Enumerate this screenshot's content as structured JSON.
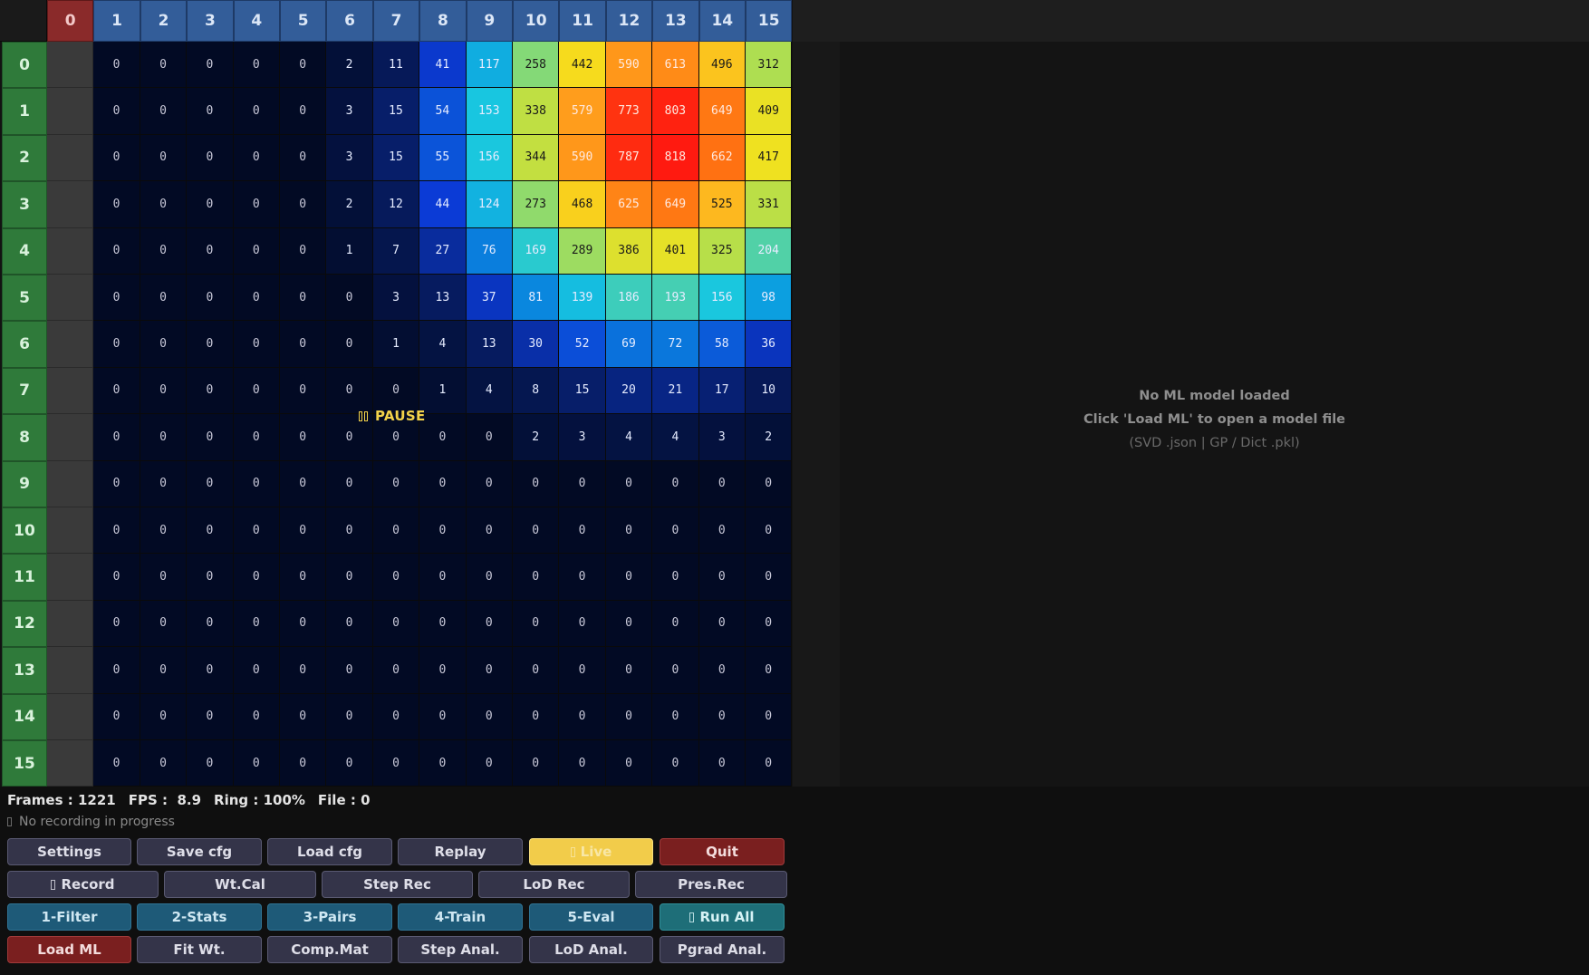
{
  "grid": {
    "col_headers": [
      "0",
      "1",
      "2",
      "3",
      "4",
      "5",
      "6",
      "7",
      "8",
      "9",
      "10",
      "11",
      "12",
      "13",
      "14",
      "15"
    ],
    "row_headers": [
      "0",
      "1",
      "2",
      "3",
      "4",
      "5",
      "6",
      "7",
      "8",
      "9",
      "10",
      "11",
      "12",
      "13",
      "14",
      "15"
    ],
    "active_col": 0,
    "values": [
      [
        null,
        0,
        0,
        0,
        0,
        0,
        2,
        11,
        41,
        117,
        258,
        442,
        590,
        613,
        496,
        312
      ],
      [
        null,
        0,
        0,
        0,
        0,
        0,
        3,
        15,
        54,
        153,
        338,
        579,
        773,
        803,
        649,
        409
      ],
      [
        null,
        0,
        0,
        0,
        0,
        0,
        3,
        15,
        55,
        156,
        344,
        590,
        787,
        818,
        662,
        417
      ],
      [
        null,
        0,
        0,
        0,
        0,
        0,
        2,
        12,
        44,
        124,
        273,
        468,
        625,
        649,
        525,
        331
      ],
      [
        null,
        0,
        0,
        0,
        0,
        0,
        1,
        7,
        27,
        76,
        169,
        289,
        386,
        401,
        325,
        204
      ],
      [
        null,
        0,
        0,
        0,
        0,
        0,
        0,
        3,
        13,
        37,
        81,
        139,
        186,
        193,
        156,
        98
      ],
      [
        null,
        0,
        0,
        0,
        0,
        0,
        0,
        1,
        4,
        13,
        30,
        52,
        69,
        72,
        58,
        36
      ],
      [
        null,
        0,
        0,
        0,
        0,
        0,
        0,
        0,
        1,
        4,
        8,
        15,
        20,
        21,
        17,
        10
      ],
      [
        null,
        0,
        0,
        0,
        0,
        0,
        0,
        0,
        0,
        0,
        2,
        3,
        4,
        4,
        3,
        2
      ],
      [
        null,
        0,
        0,
        0,
        0,
        0,
        0,
        0,
        0,
        0,
        0,
        0,
        0,
        0,
        0,
        0
      ],
      [
        null,
        0,
        0,
        0,
        0,
        0,
        0,
        0,
        0,
        0,
        0,
        0,
        0,
        0,
        0,
        0
      ],
      [
        null,
        0,
        0,
        0,
        0,
        0,
        0,
        0,
        0,
        0,
        0,
        0,
        0,
        0,
        0,
        0
      ],
      [
        null,
        0,
        0,
        0,
        0,
        0,
        0,
        0,
        0,
        0,
        0,
        0,
        0,
        0,
        0,
        0
      ],
      [
        null,
        0,
        0,
        0,
        0,
        0,
        0,
        0,
        0,
        0,
        0,
        0,
        0,
        0,
        0,
        0
      ],
      [
        null,
        0,
        0,
        0,
        0,
        0,
        0,
        0,
        0,
        0,
        0,
        0,
        0,
        0,
        0,
        0
      ],
      [
        null,
        0,
        0,
        0,
        0,
        0,
        0,
        0,
        0,
        0,
        0,
        0,
        0,
        0,
        0,
        0
      ]
    ],
    "colormap": {
      "stops": [
        "#020a24",
        "#061a5c",
        "#0b3bd6",
        "#0a9ae0",
        "#18c7e0",
        "#6fd68a",
        "#b6df4a",
        "#f5e11c",
        "#ffb020",
        "#ff6a10",
        "#ff1a10"
      ],
      "max": 818
    },
    "pause_label": "PAUSE"
  },
  "ml_panel": {
    "line1": "No ML model loaded",
    "line2": "Click  'Load ML'  to open a model file",
    "line3": "(SVD .json  |  GP / Dict .pkl)"
  },
  "status": {
    "frames": "Frames : 1221",
    "fps": "FPS :  8.9",
    "ring": "Ring : 100%",
    "file": "File : 0",
    "recording": "No recording in progress"
  },
  "buttons": {
    "row1": [
      "Settings",
      "Save cfg",
      "Load cfg",
      "Replay",
      "Live",
      "Quit"
    ],
    "row2": [
      "Record",
      "Wt.Cal",
      "Step Rec",
      "LoD Rec",
      "Pres.Rec"
    ],
    "row3": [
      "1-Filter",
      "2-Stats",
      "3-Pairs",
      "4-Train",
      "5-Eval",
      "Run All"
    ],
    "row4": [
      "Load ML",
      "Fit Wt.",
      "Comp.Mat",
      "Step Anal.",
      "LoD Anal.",
      "Pgrad Anal."
    ]
  },
  "colors": {
    "col_header": "#335d99",
    "row_header": "#2f7a3a",
    "active_header": "#8a2a2a",
    "live_button": "#f2cc4a",
    "quit_button": "#7a1f1f",
    "run_all_button": "#1e6e78"
  }
}
